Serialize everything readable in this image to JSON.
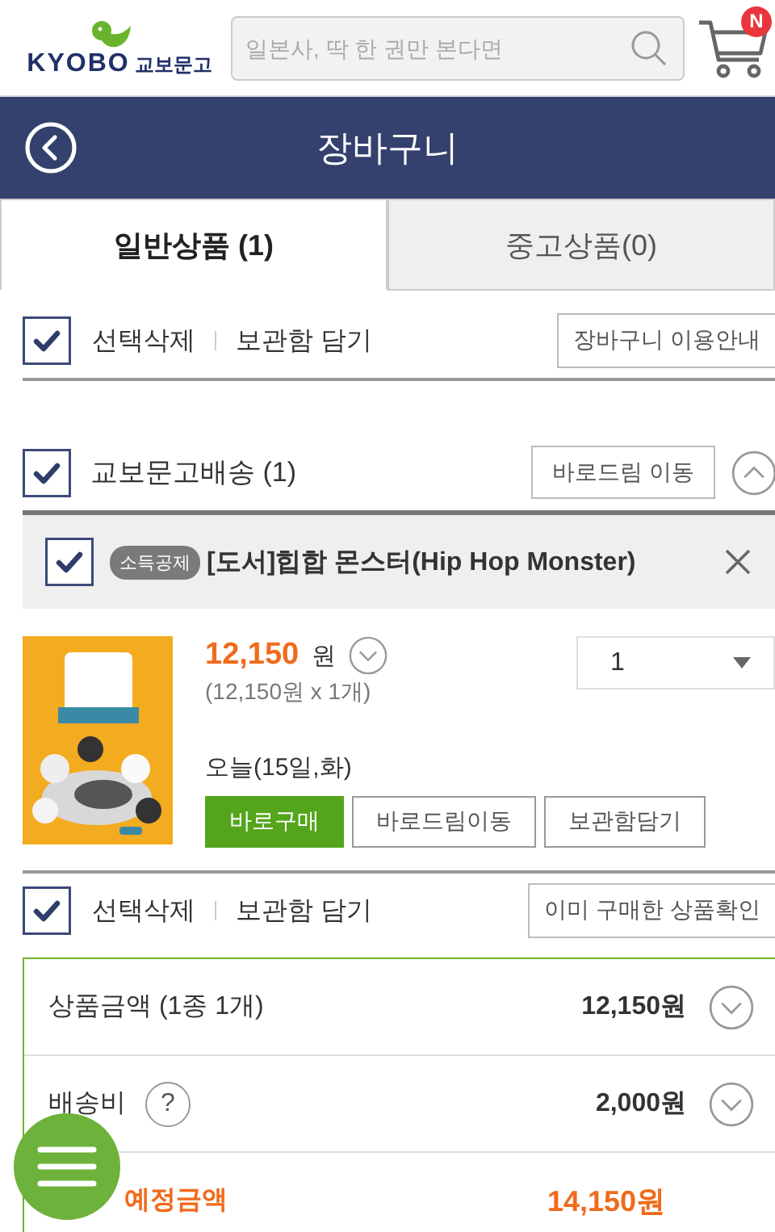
{
  "header": {
    "logo_latin": "KYOBO",
    "logo_korean": "교보문고",
    "search": {
      "placeholder": "일본사, 딱 한 권만 본다면"
    },
    "cart_badge": "N"
  },
  "title_bar": {
    "title": "장바구니"
  },
  "tabs": [
    {
      "label": "일반상품 (1)",
      "selected": true
    },
    {
      "label": "중고상품(0)",
      "selected": false
    }
  ],
  "top_actions": {
    "checked": true,
    "links": [
      "선택삭제",
      "보관함 담기"
    ],
    "button": "장바구니 이용안내"
  },
  "delivery_group": {
    "checked": true,
    "title": "교보문고배송 (1)",
    "button": "바로드림 이동",
    "expanded": true
  },
  "items": [
    {
      "checked": true,
      "badge": "소득공제",
      "title": "[도서]힙합 몬스터(Hip Hop Monster)",
      "price": "12,150",
      "currency": "원",
      "price_detail": "(12,150원 x 1개)",
      "quantity": "1",
      "delivery": "오늘(15일,화)",
      "buttons": [
        {
          "label": "바로구매",
          "kind": "primary"
        },
        {
          "label": "바로드림이동",
          "kind": "secondary"
        },
        {
          "label": "보관함담기",
          "kind": "secondary"
        }
      ]
    }
  ],
  "bottom_actions": {
    "checked": true,
    "links": [
      "선택삭제",
      "보관함 담기"
    ],
    "button": "이미 구매한 상품확인"
  },
  "summary": {
    "rows": [
      {
        "kind": "normal",
        "label": "상품금액 (1종 1개)",
        "value": "12,150원",
        "expandable": true
      },
      {
        "kind": "normal",
        "label": "배송비",
        "help": "?",
        "value": "2,000원",
        "expandable": true
      },
      {
        "kind": "total",
        "label": "예정금액",
        "value": "14,150원",
        "expandable": false
      }
    ]
  }
}
